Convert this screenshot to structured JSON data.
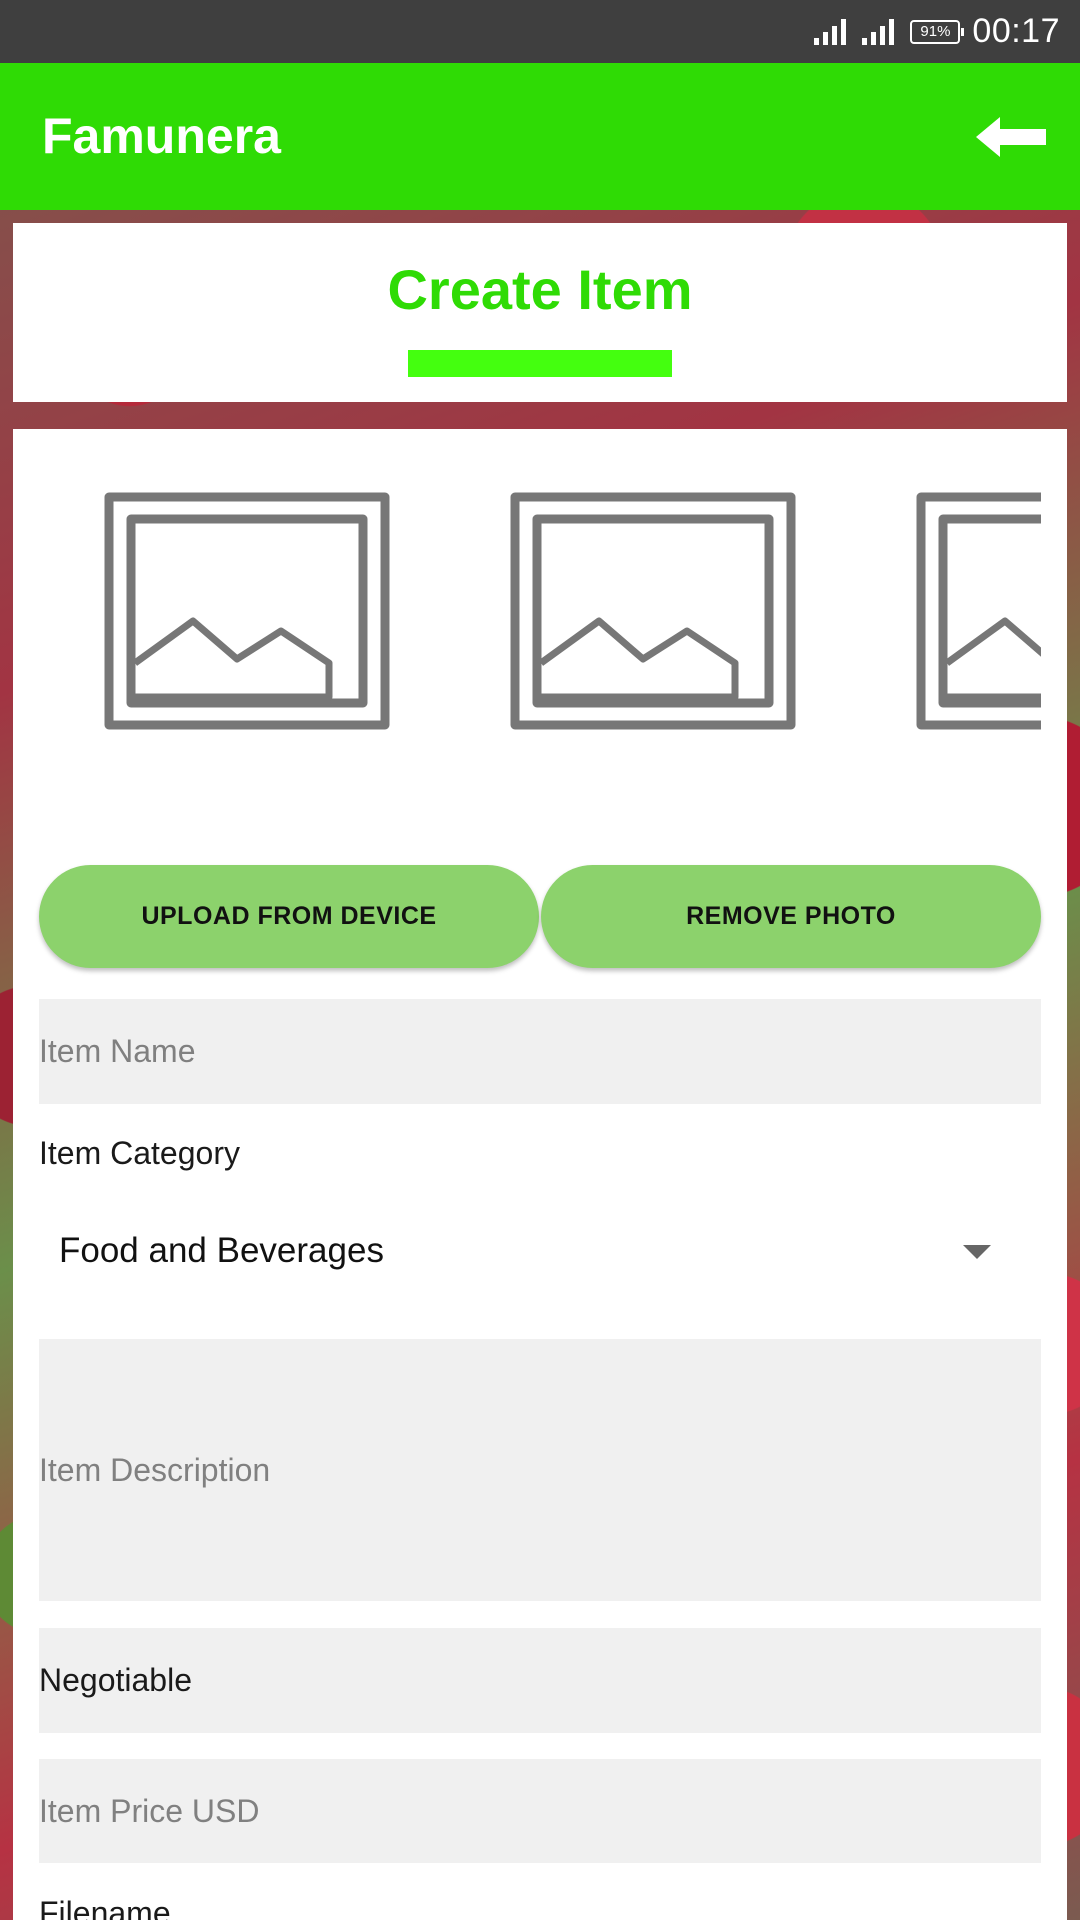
{
  "status_bar": {
    "battery": "91%",
    "time": "00:17"
  },
  "app_bar": {
    "title": "Famunera",
    "back_icon": "arrow-left-icon"
  },
  "header": {
    "title": "Create Item"
  },
  "photos": {
    "slots": [
      "image-placeholder-icon",
      "image-placeholder-icon",
      "image-placeholder-icon"
    ]
  },
  "buttons": {
    "upload": "UPLOAD FROM DEVICE",
    "remove": "REMOVE PHOTO"
  },
  "form": {
    "item_name_placeholder": "Item Name",
    "category_label": "Item Category",
    "category_value": "Food and Beverages",
    "description_placeholder": "Item Description",
    "negotiable": "Negotiable",
    "price_placeholder": "Item Price USD",
    "next_label": "Filename"
  },
  "colors": {
    "primary": "#2fdb05",
    "accent": "#44ff0f",
    "button": "#8cd26c",
    "status_bar": "#3f3f3f",
    "field_bg": "#f0f0f0"
  }
}
